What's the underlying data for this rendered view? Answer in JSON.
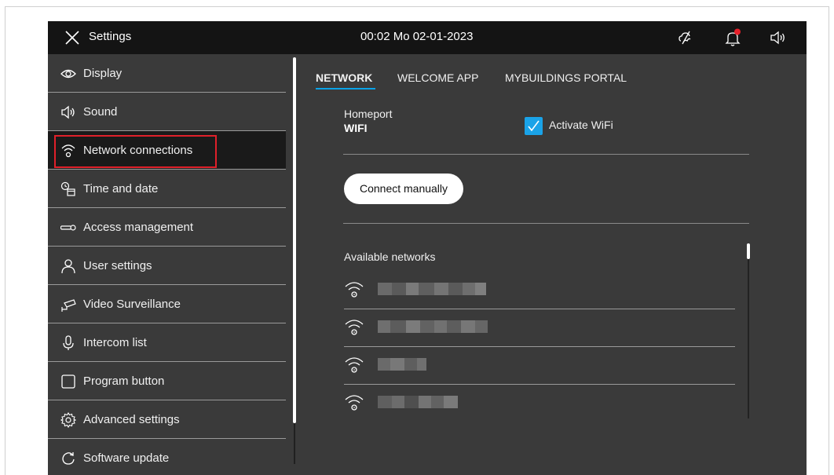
{
  "topbar": {
    "title": "Settings",
    "clock": "00:02  Mo 02-01-2023",
    "icons": [
      "close-icon",
      "cloud-off-icon",
      "bell-notification-icon",
      "speaker-icon"
    ],
    "notification_dot_color": "#e8202a"
  },
  "sidebar": {
    "items": [
      {
        "label": "Display",
        "icon": "eye-icon"
      },
      {
        "label": "Sound",
        "icon": "speaker-icon"
      },
      {
        "label": "Network connections",
        "icon": "wifi-icon",
        "active": true
      },
      {
        "label": "Time and date",
        "icon": "clock-calendar-icon"
      },
      {
        "label": "Access  management",
        "icon": "key-icon"
      },
      {
        "label": "User settings",
        "icon": "user-icon"
      },
      {
        "label": "Video Surveillance",
        "icon": "camera-icon"
      },
      {
        "label": "Intercom list",
        "icon": "microphone-icon"
      },
      {
        "label": "Program button",
        "icon": "square-icon"
      },
      {
        "label": "Advanced settings",
        "icon": "gear-icon"
      },
      {
        "label": "Software update",
        "icon": "refresh-icon"
      }
    ]
  },
  "tabs": [
    {
      "label": "NETWORK",
      "active": true
    },
    {
      "label": "WELCOME APP"
    },
    {
      "label": "MYBUILDINGS PORTAL"
    }
  ],
  "network": {
    "homeport_label": "Homeport",
    "homeport_value": "WIFI",
    "activate_wifi_label": "Activate WiFi",
    "activate_wifi_checked": true,
    "connect_manually_label": "Connect manually",
    "available_networks_label": "Available networks"
  },
  "colors": {
    "accent": "#0aa3e8",
    "checkbox": "#1aa3e8",
    "highlight": "#e0202a",
    "panel": "#3a3a3a",
    "topbar": "#141414"
  }
}
